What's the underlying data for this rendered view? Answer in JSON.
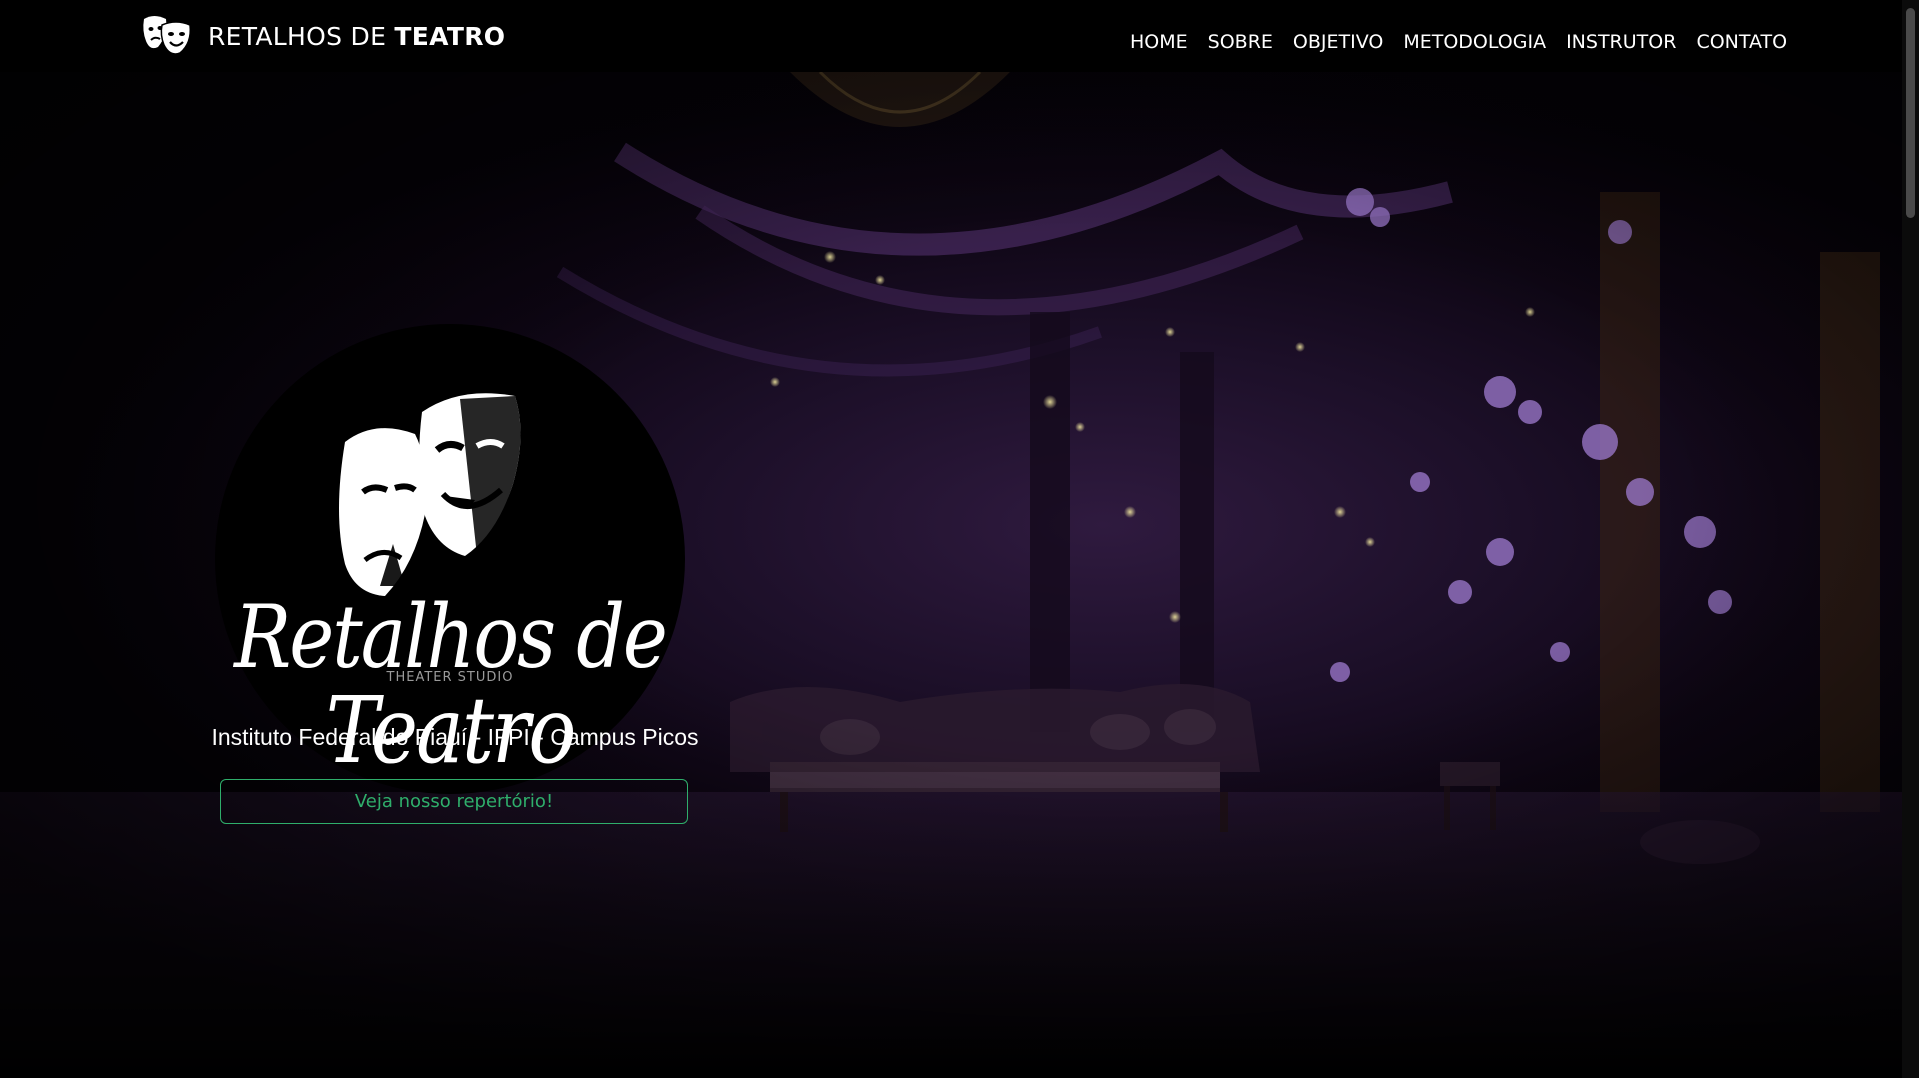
{
  "navbar": {
    "brand_icon": "theater-masks-icon",
    "brand_prefix": "RETALHOS DE ",
    "brand_bold": "TEATRO",
    "links": [
      "HOME",
      "SOBRE",
      "OBJETIVO",
      "METODOLOGIA",
      "INSTRUTOR",
      "CONTATO"
    ]
  },
  "hero": {
    "logo": {
      "line1": "Retalhos de",
      "subtitle": "THEATER STUDIO",
      "line2": "Teatro"
    },
    "campus": "Instituto Federal do Piauí - IFPI - Campus Picos",
    "cta_label": "Veja nosso repertório!"
  },
  "colors": {
    "background": "#000000",
    "accent_green": "#2fae6b",
    "purple_tint": "#2f1a3f"
  }
}
